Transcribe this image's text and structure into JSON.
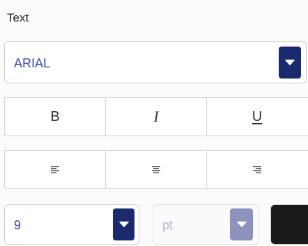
{
  "section": {
    "title": "Text"
  },
  "font_select": {
    "value": "ARIAL",
    "icon": "chevron-down-icon"
  },
  "format_buttons": [
    {
      "label": "B",
      "name": "bold-button"
    },
    {
      "label": "I",
      "name": "italic-button"
    },
    {
      "label": "U",
      "name": "underline-button"
    }
  ],
  "align_buttons": [
    {
      "name": "align-left-button",
      "icon": "align-left-icon"
    },
    {
      "name": "align-center-button",
      "icon": "align-center-icon"
    },
    {
      "name": "align-right-button",
      "icon": "align-right-icon"
    }
  ],
  "size_select": {
    "value": "9",
    "icon": "chevron-down-icon"
  },
  "unit_select": {
    "value": "pt",
    "disabled": true,
    "icon": "chevron-down-icon"
  },
  "color": {
    "value": "#1a1a1a"
  },
  "colors": {
    "accent": "#1a2a6e",
    "value_text": "#3347c9",
    "disabled_accent": "#8c93bd"
  }
}
